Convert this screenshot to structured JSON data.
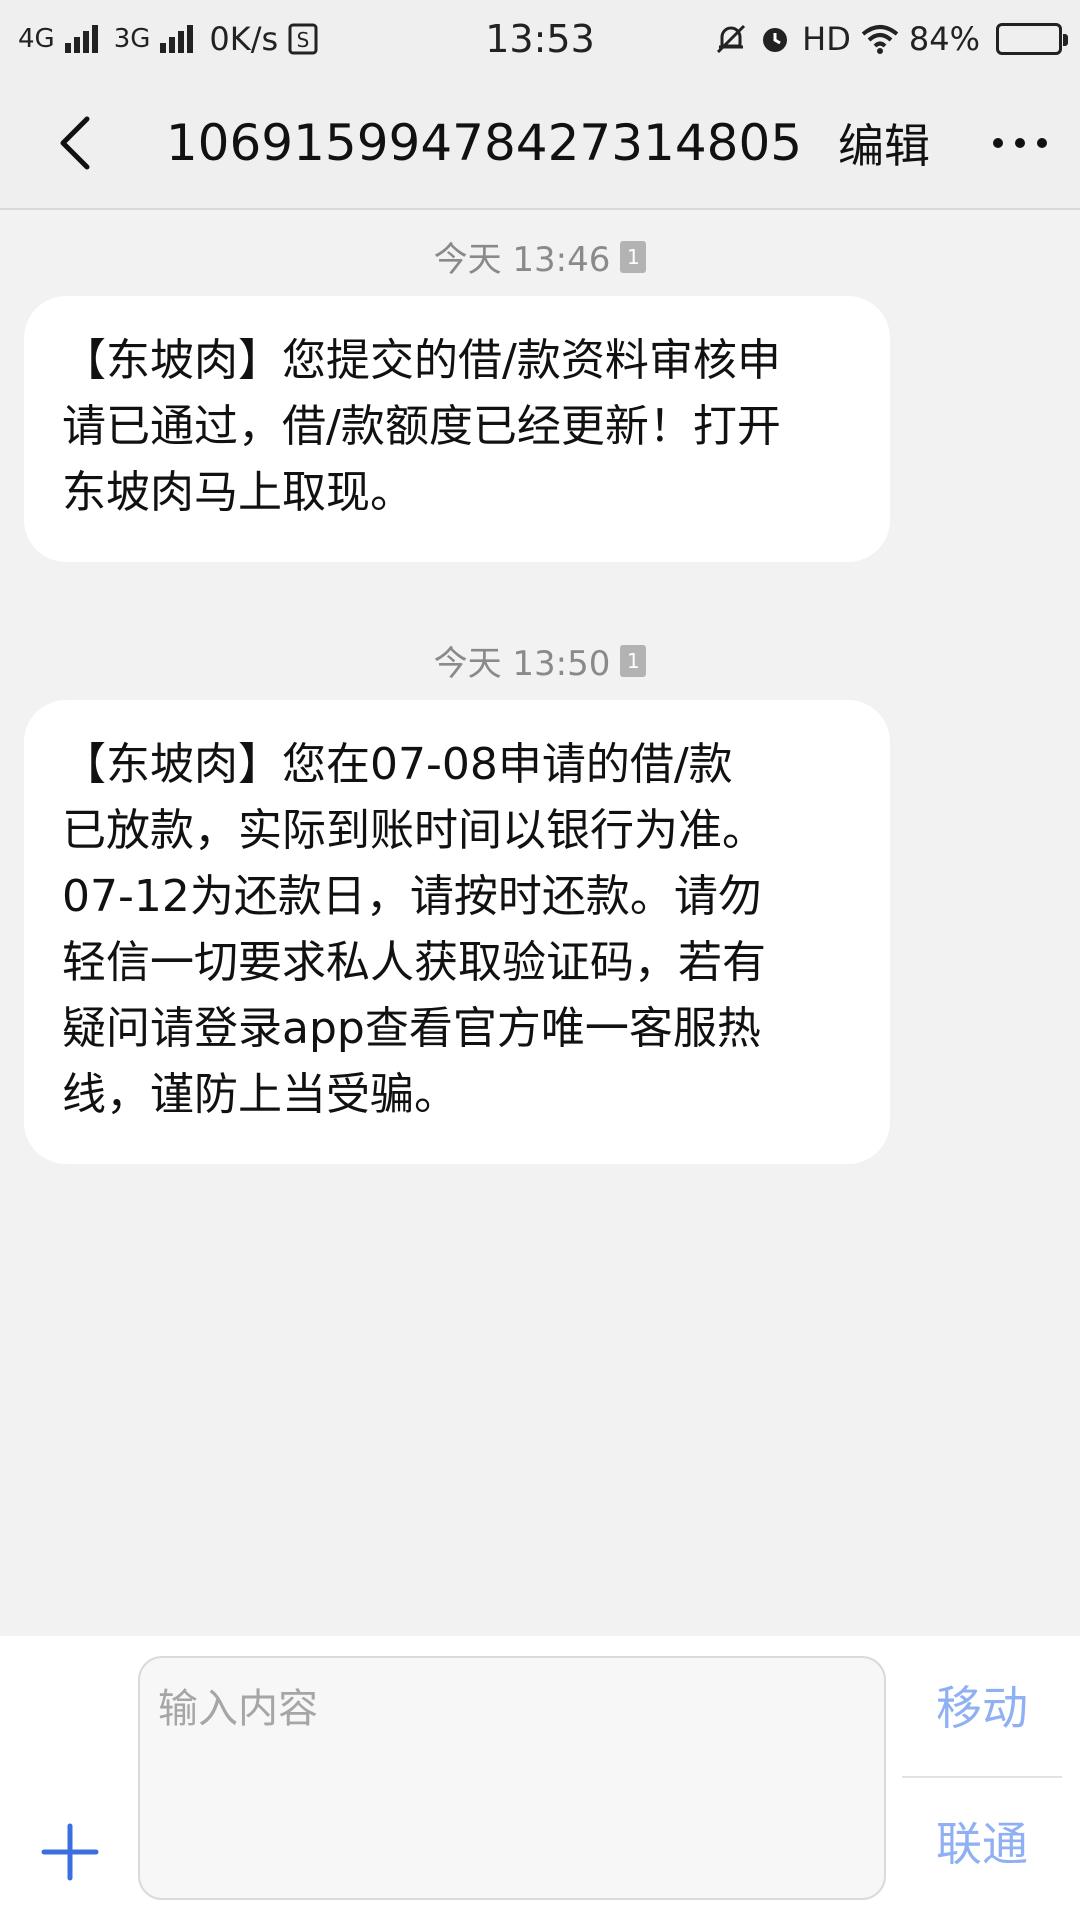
{
  "status_bar": {
    "network1": "4G",
    "network2": "3G",
    "speed": "0K/s",
    "time": "13:53",
    "hd": "HD",
    "battery_text": "84%",
    "battery_level": 0.84
  },
  "header": {
    "title": "1069159947842731480​5",
    "edit_label": "编辑"
  },
  "messages": [
    {
      "timestamp": "今天 13:46",
      "sim": "1",
      "text": "【东坡肉】您提交的借/款资料审核申\n请已通过，借/款额度已经更新！打开\n东坡肉马上取现。"
    },
    {
      "timestamp": "今天 13:50",
      "sim": "1",
      "text": "【东坡肉】您在07-08申请的借/款\n已放款，实际到账时间以银行为准。\n07-12为还款日，请按时还款。请勿\n轻信一切要求私人获取验证码，若有\n疑问请登录app查看官方唯一客服热\n线，谨防上当受骗。"
    }
  ],
  "composer": {
    "placeholder": "输入内容",
    "send_mobile": "移动",
    "send_unicom": "联通"
  },
  "colors": {
    "accent": "#3b6fe0",
    "send_text": "#8fb0f2"
  }
}
